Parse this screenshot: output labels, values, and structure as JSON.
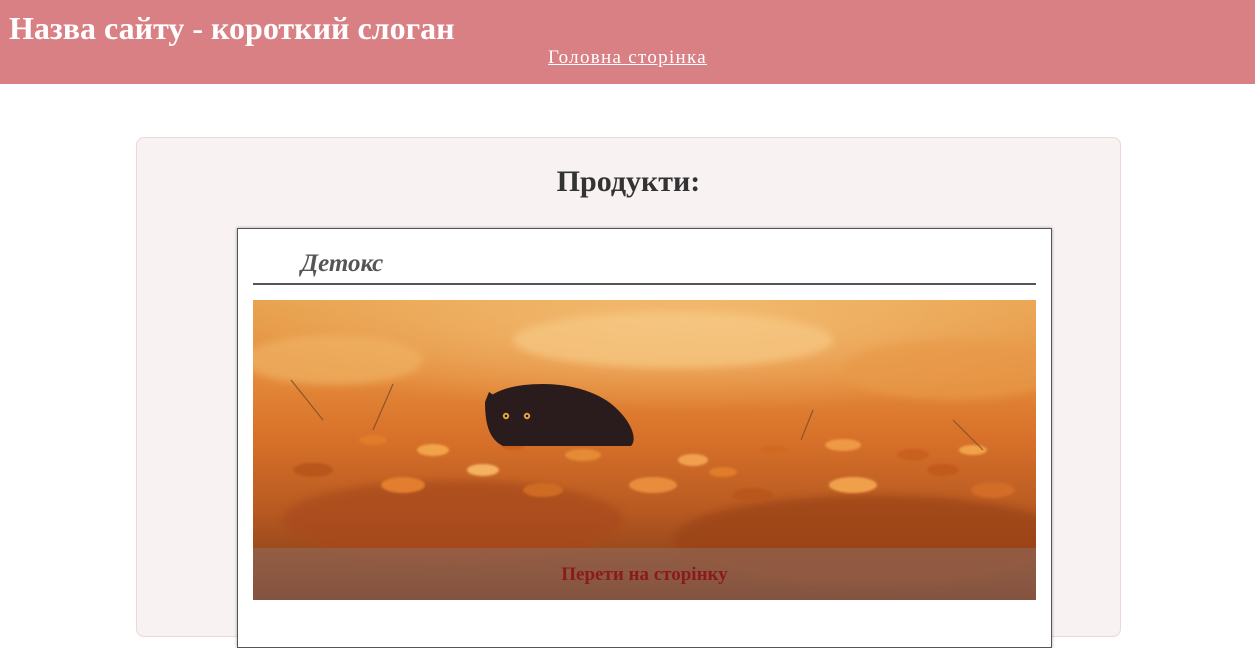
{
  "header": {
    "site_title": "Назва сайту - короткий слоган",
    "nav_link": "Головна сторінка"
  },
  "main": {
    "section_title": "Продукти:",
    "products": [
      {
        "name": "Детокс",
        "image": "cat-in-autumn-leaves",
        "link_label": "Перети на сторінку"
      }
    ]
  },
  "colors": {
    "header_bg": "#d98085",
    "panel_bg": "#f8f2f2",
    "link_text": "#8b1a1a"
  }
}
